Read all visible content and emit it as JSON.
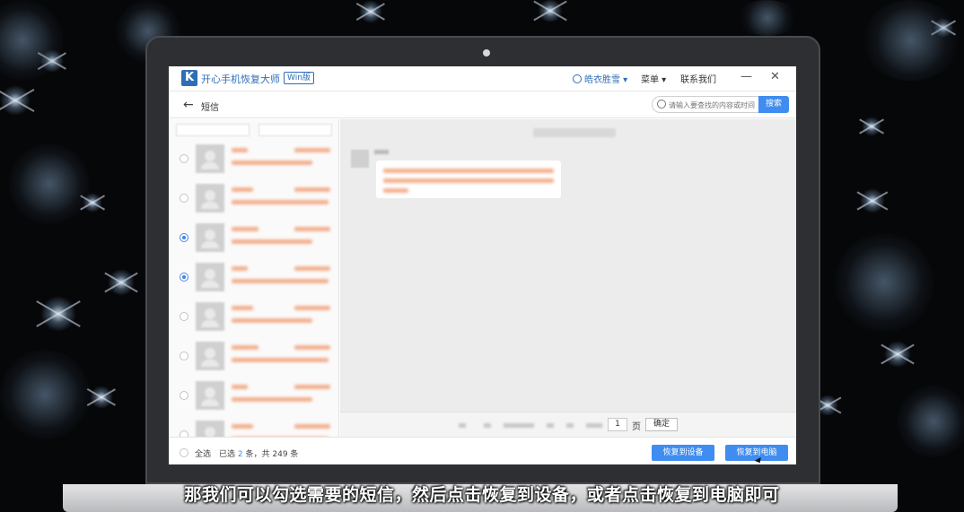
{
  "app": {
    "logo_letter": "K",
    "title": "开心手机恢复大师",
    "badge": "Win版",
    "user_name": "皓衣胜雪",
    "menu_label": "菜单",
    "contact_label": "联系我们",
    "minimize_glyph": "—",
    "close_glyph": "✕"
  },
  "nav": {
    "back_glyph": "←",
    "title": "短信",
    "search_placeholder": "请输入要查找的内容或时间",
    "search_button": "搜索"
  },
  "list": {
    "items": [
      {
        "checked": false
      },
      {
        "checked": false
      },
      {
        "checked": true
      },
      {
        "checked": true
      },
      {
        "checked": false
      },
      {
        "checked": false
      },
      {
        "checked": false
      },
      {
        "checked": false
      }
    ]
  },
  "pager": {
    "page_value": "1",
    "page_unit": "页",
    "confirm_label": "确定"
  },
  "footer": {
    "select_all": "全选",
    "selected_prefix": "已选",
    "selected_count": "2",
    "selected_suffix": "条，共 249 条",
    "restore_device": "恢复到设备",
    "restore_pc": "恢复到电脑"
  },
  "subtitle": "那我们可以勾选需要的短信，然后点击恢复到设备，或者点击恢复到电脑即可",
  "colors": {
    "accent": "#3f8df0",
    "brand": "#2f6db5",
    "blurred_text": "#f2a27a"
  }
}
